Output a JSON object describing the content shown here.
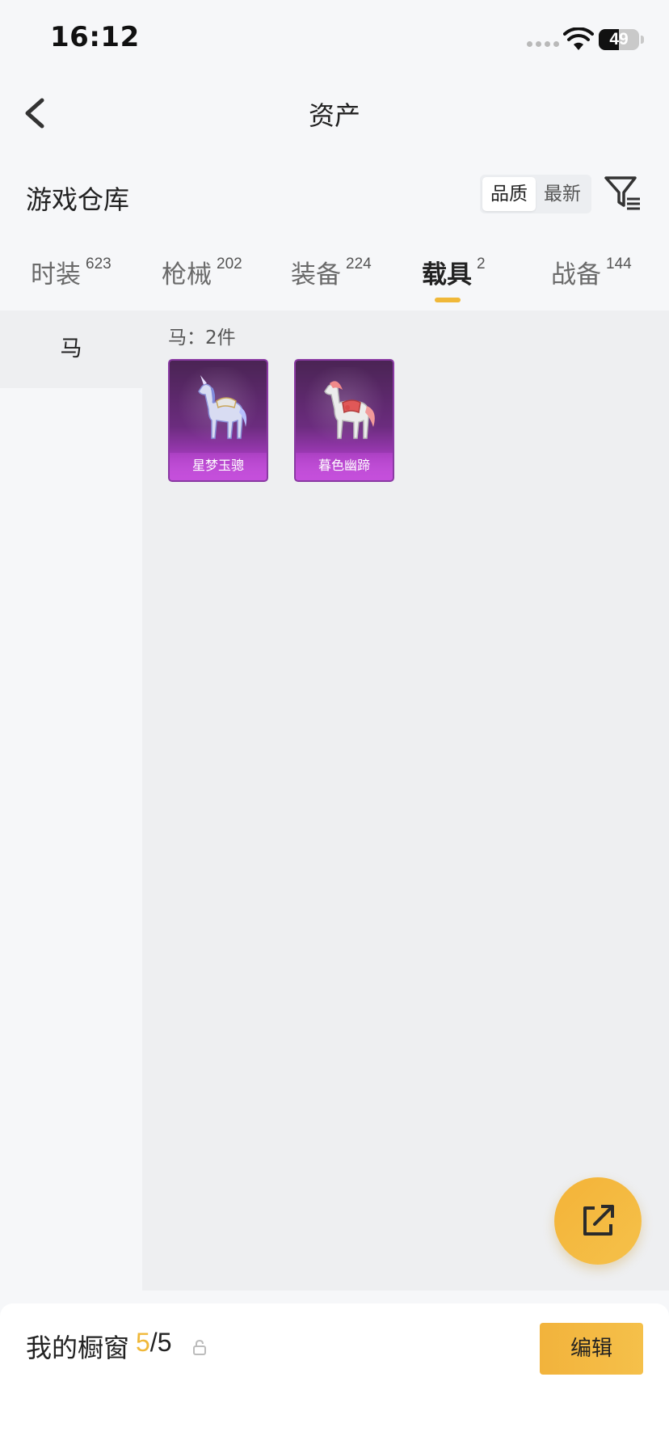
{
  "status_bar": {
    "time": "16:12",
    "battery": "49",
    "battery_level": 0.49
  },
  "nav": {
    "title": "资产"
  },
  "section": {
    "title": "游戏仓库",
    "sort_options": [
      {
        "label": "品质",
        "active": true
      },
      {
        "label": "最新",
        "active": false
      }
    ]
  },
  "tabs": [
    {
      "label": "时装",
      "count": "623",
      "active": false
    },
    {
      "label": "枪械",
      "count": "202",
      "active": false
    },
    {
      "label": "装备",
      "count": "224",
      "active": false
    },
    {
      "label": "载具",
      "count": "2",
      "active": true
    },
    {
      "label": "战备",
      "count": "144",
      "active": false
    }
  ],
  "sidebar": {
    "items": [
      {
        "label": "马",
        "active": true
      }
    ]
  },
  "content": {
    "count_label": "马：2件",
    "items": [
      {
        "name": "星梦玉骢",
        "rarity_color": "#a03ab9"
      },
      {
        "name": "暮色幽蹄",
        "rarity_color": "#a03ab9"
      }
    ]
  },
  "bottom": {
    "label": "我的橱窗",
    "used": "5",
    "total": "/5",
    "edit_label": "编辑"
  },
  "colors": {
    "accent": "#f0b839",
    "card_purple": "#6b2c7e"
  },
  "icons": {
    "back": "chevron-left-icon",
    "filter": "filter-icon",
    "share": "share-external-icon",
    "lock": "lock-icon"
  }
}
